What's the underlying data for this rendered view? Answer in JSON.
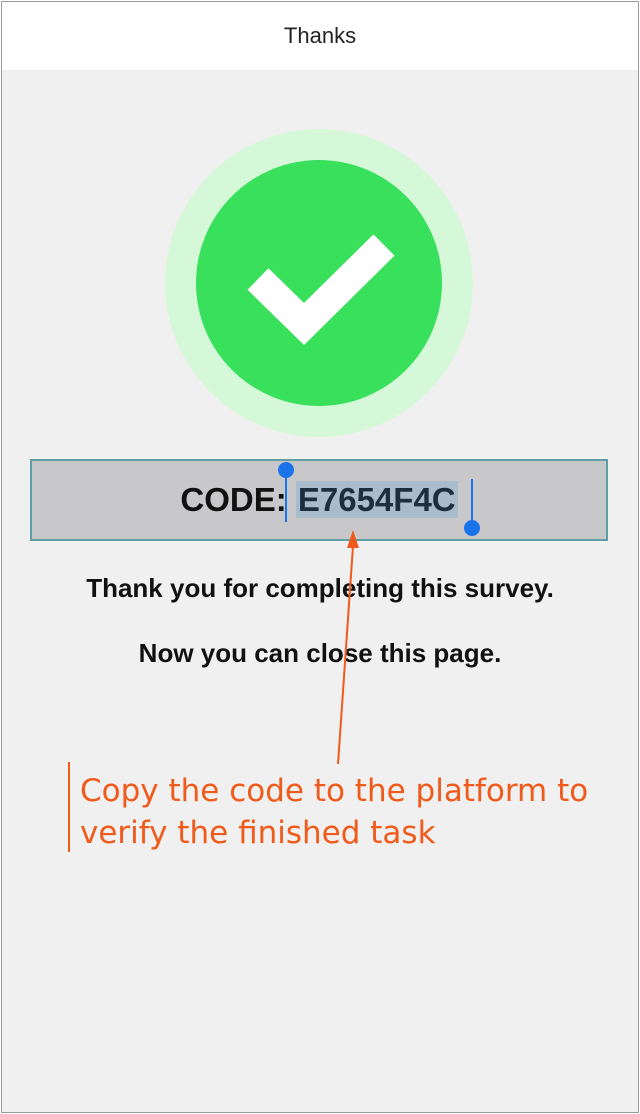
{
  "nav": {
    "title": "Thanks"
  },
  "status": {
    "success_icon": "check-circle-icon",
    "accent_color": "#38e05c",
    "halo_color": "#d5f9d8"
  },
  "code": {
    "label": "CODE: ",
    "value": "E7654F4C"
  },
  "messages": {
    "line1": "Thank you for completing this survey.",
    "line2": "Now you can close this page."
  },
  "annotation": {
    "line1": "Copy the code to the platform to",
    "line2": "verify the finished task",
    "color": "#f05a1a"
  }
}
